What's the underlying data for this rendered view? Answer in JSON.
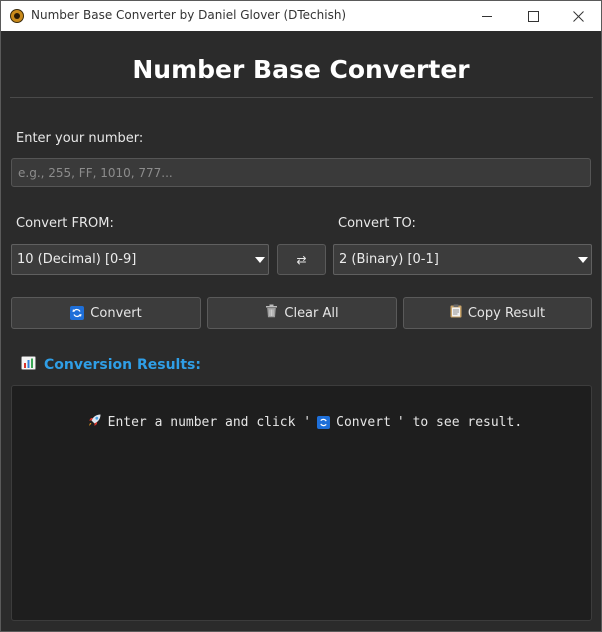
{
  "window": {
    "title": "Number Base Converter by Daniel Glover (DTechish)"
  },
  "header": {
    "title": "Number Base Converter"
  },
  "input": {
    "label": "Enter your number:",
    "placeholder": "e.g., 255, FF, 1010, 777...",
    "value": ""
  },
  "from": {
    "label": "Convert FROM:",
    "selected": "10 (Decimal) [0-9]"
  },
  "to": {
    "label": "Convert TO:",
    "selected": "2 (Binary) [0-1]"
  },
  "swap_label": "⇄",
  "buttons": {
    "convert": "Convert",
    "clear": "Clear All",
    "copy": "Copy Result"
  },
  "results": {
    "title": "Conversion Results:",
    "message_prefix": "Enter a number and click '",
    "message_button": "Convert",
    "message_suffix": "' to see result."
  },
  "colors": {
    "accent": "#2f9ee6",
    "background": "#2b2b2b",
    "results_bg": "#1e1e1e"
  },
  "icons": {
    "convert": "refresh-icon",
    "clear": "trash-icon",
    "copy": "clipboard-icon",
    "results": "bar-chart-icon",
    "message": "rocket-icon"
  }
}
